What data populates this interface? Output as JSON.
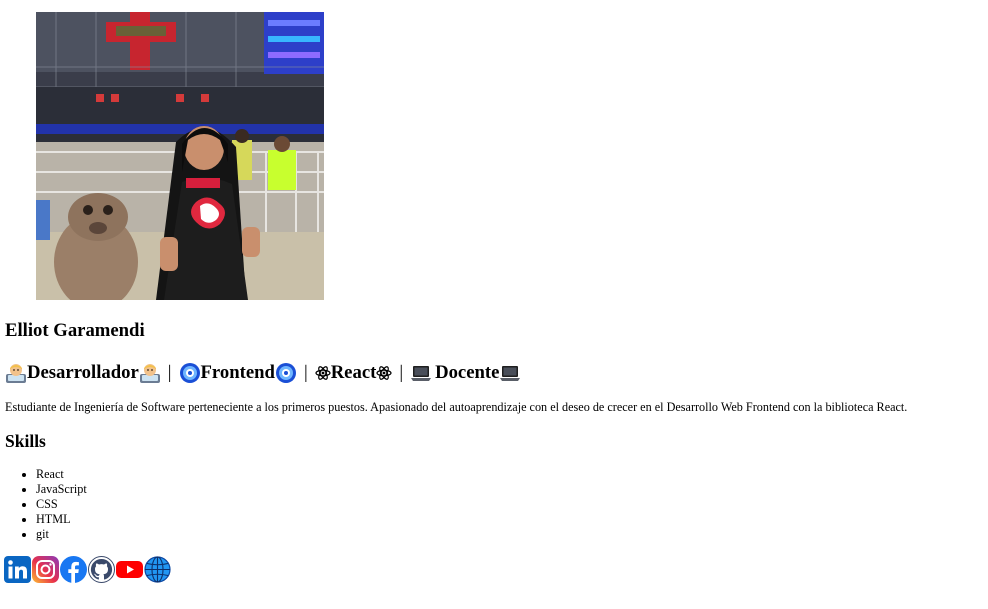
{
  "profile": {
    "photo_alt": "Foto de perfil",
    "name": "Elliot Garamendi",
    "roles": [
      "Desarrollador",
      "Frontend",
      "React",
      "Docente"
    ],
    "separator": "|",
    "bio": "Estudiante de Ingeniería de Software perteneciente a los primeros puestos. Apasionado del autoaprendizaje con el deseo de crecer en el Desarrollo Web Frontend con la biblioteca React."
  },
  "role_icons": [
    "technologist-emoji",
    "comet-disc-emoji",
    "atom-emoji",
    "laptop-emoji"
  ],
  "skills": {
    "title": "Skills",
    "items": [
      "React",
      "JavaScript",
      "CSS",
      "HTML",
      "git"
    ]
  },
  "social": [
    {
      "name": "linkedin-icon",
      "color": "#0a66c2"
    },
    {
      "name": "instagram-icon",
      "color": "#e1306c"
    },
    {
      "name": "facebook-icon",
      "color": "#1877f2"
    },
    {
      "name": "github-icon",
      "color": "#333333"
    },
    {
      "name": "youtube-icon",
      "color": "#ff0000"
    },
    {
      "name": "globe-icon",
      "color": "#1e88e5"
    }
  ]
}
